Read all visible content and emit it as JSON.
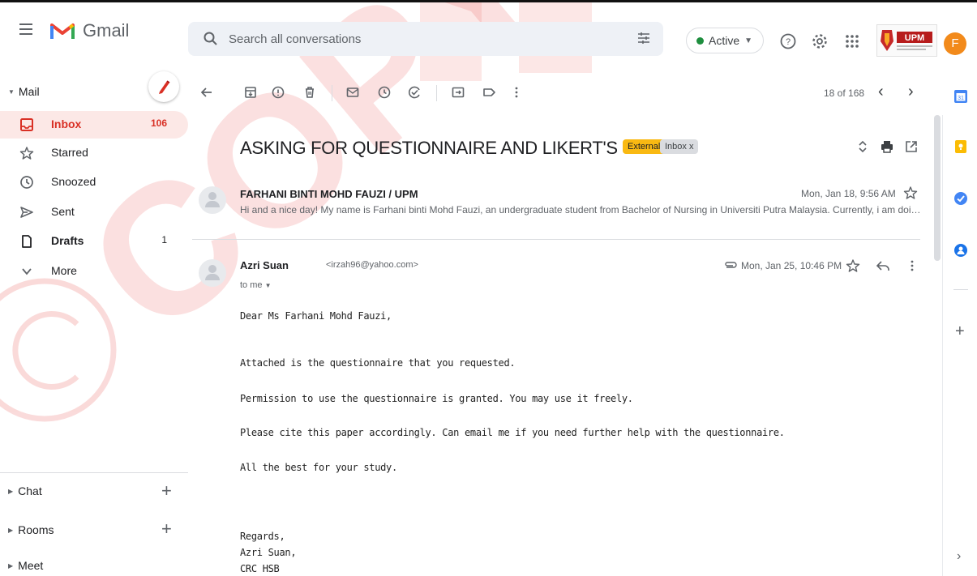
{
  "app": {
    "name": "Gmail"
  },
  "search": {
    "placeholder": "Search all conversations"
  },
  "status": {
    "label": "Active"
  },
  "account": {
    "initial": "F",
    "logo_text": "UPM"
  },
  "nav": {
    "mail_label": "Mail",
    "items": [
      {
        "label": "Inbox",
        "count": "106"
      },
      {
        "label": "Starred",
        "count": ""
      },
      {
        "label": "Snoozed",
        "count": ""
      },
      {
        "label": "Sent",
        "count": ""
      },
      {
        "label": "Drafts",
        "count": "1"
      },
      {
        "label": "More",
        "count": ""
      }
    ],
    "sections": [
      {
        "label": "Chat"
      },
      {
        "label": "Rooms"
      },
      {
        "label": "Meet"
      }
    ]
  },
  "toolbar": {
    "pager": "18 of 168"
  },
  "thread": {
    "subject": "ASKING FOR QUESTIONNAIRE AND LIKERT'S SCALE",
    "badge_external": "External",
    "badge_inbox": "Inbox x",
    "messages": [
      {
        "sender": "FARHANI BINTI MOHD FAUZI / UPM",
        "date": "Mon, Jan 18, 9:56 AM",
        "snippet": "Hi and a nice day! My name is Farhani binti Mohd Fauzi, an undergraduate student from Bachelor of Nursing in Universiti Putra Malaysia. Currently, i am doin..."
      },
      {
        "sender": "Azri Suan",
        "email": "<irzah96@yahoo.com>",
        "date": "Mon, Jan 25, 10:46 PM",
        "to": "to me",
        "body": [
          "Dear Ms Farhani Mohd Fauzi,",
          "Attached is the questionnaire that you requested.",
          "Permission to use the questionnaire is granted. You may use it freely.",
          "Please cite this paper accordingly. Can email me if you need further help with the questionnaire.",
          "All the best for your study.",
          "Regards,",
          "Azri Suan,",
          "CRC HSB"
        ]
      }
    ]
  },
  "watermark": {
    "text": "COPY",
    "symbol": "©"
  },
  "colors": {
    "accent": "#d93025",
    "selected_bg": "#fce8e6",
    "external": "#f9b912",
    "watermark": "#e53935"
  }
}
